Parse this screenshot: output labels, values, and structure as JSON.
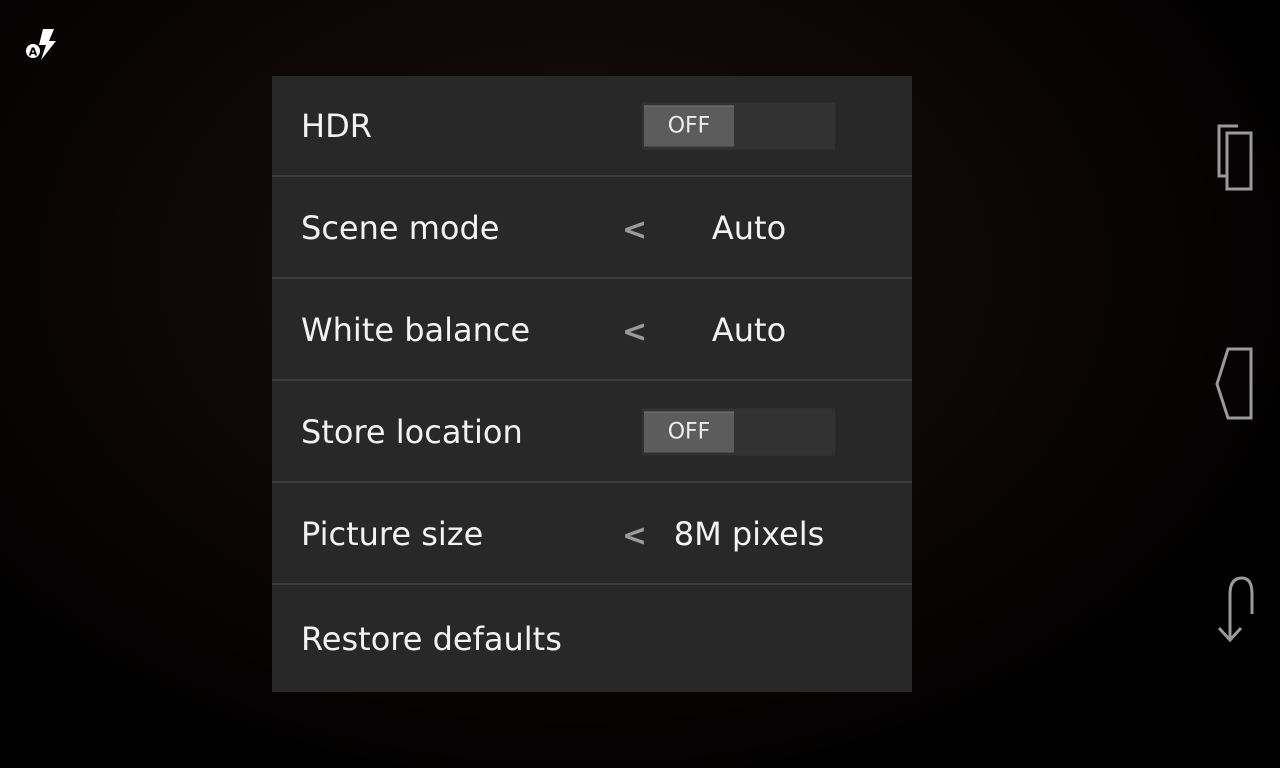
{
  "camera": {
    "flash_mode_badge": "A",
    "settings": [
      {
        "label": "HDR",
        "control": "toggle",
        "value": "OFF"
      },
      {
        "label": "Scene mode",
        "control": "selector",
        "value": "Auto",
        "prev_glyph": "<"
      },
      {
        "label": "White balance",
        "control": "selector",
        "value": "Auto",
        "prev_glyph": "<"
      },
      {
        "label": "Store location",
        "control": "toggle",
        "value": "OFF"
      },
      {
        "label": "Picture size",
        "control": "selector",
        "value": "8M pixels",
        "prev_glyph": "<"
      },
      {
        "label": "Restore defaults",
        "control": "action"
      }
    ]
  },
  "navbar": {
    "buttons": [
      "recent-apps-icon",
      "home-icon",
      "back-icon"
    ]
  },
  "colors": {
    "panel": "#282828",
    "divider": "#3c3c3c",
    "text": "#f2f2f2",
    "toggle_knob": "#5c5c5c"
  }
}
